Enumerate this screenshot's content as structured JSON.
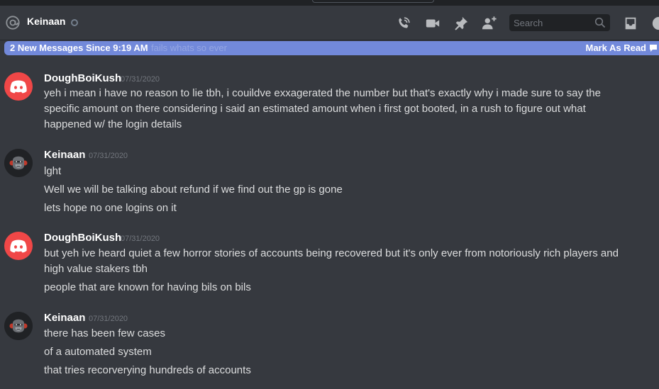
{
  "header": {
    "channel_name": "Keinaan",
    "search_placeholder": "Search",
    "icons": [
      "at-icon",
      "status-offline-icon",
      "phone-call-icon",
      "video-call-icon",
      "pin-icon",
      "add-friend-icon",
      "search-icon",
      "inbox-icon",
      "help-icon"
    ]
  },
  "new_messages_bar": {
    "label": "2 New Messages Since 9:19 AM",
    "ghost_text": "fails whats so ever",
    "mark_as_read": "Mark As Read"
  },
  "colors": {
    "background": "#36393f",
    "blurple": "#7289da",
    "discord_red": "#f04747",
    "timestamp": "#72767d"
  },
  "messages": [
    {
      "author": "DoughBoiKush",
      "timestamp": "07/31/2020",
      "avatar": "discord-default-red-avatar",
      "lines": [
        "yeh i mean i have no reason to lie tbh, i couildve exxagerated the number but that's exactly why i made sure to say the",
        "specific amount on there considering i said an estimated amount when i first got booted, in a rush to figure out what",
        "happened w/ the login details"
      ]
    },
    {
      "author": "Keinaan",
      "timestamp": "07/31/2020",
      "avatar": "gorilla-avatar",
      "lines": [
        "lght",
        "Well we will be talking about refund if we find out the gp is gone",
        "lets hope no one logins on it"
      ]
    },
    {
      "author": "DoughBoiKush",
      "timestamp": "07/31/2020",
      "avatar": "discord-default-red-avatar",
      "lines": [
        "but yeh ive heard quiet a few horror stories of accounts being recovered but it's only ever from notoriously rich players and",
        "high value stakers tbh",
        "people that are known for having bils on bils"
      ]
    },
    {
      "author": "Keinaan",
      "timestamp": "07/31/2020",
      "avatar": "gorilla-avatar",
      "lines": [
        "there has been few cases",
        "of a automated system",
        "that tries recorverying hundreds of accounts"
      ]
    }
  ]
}
